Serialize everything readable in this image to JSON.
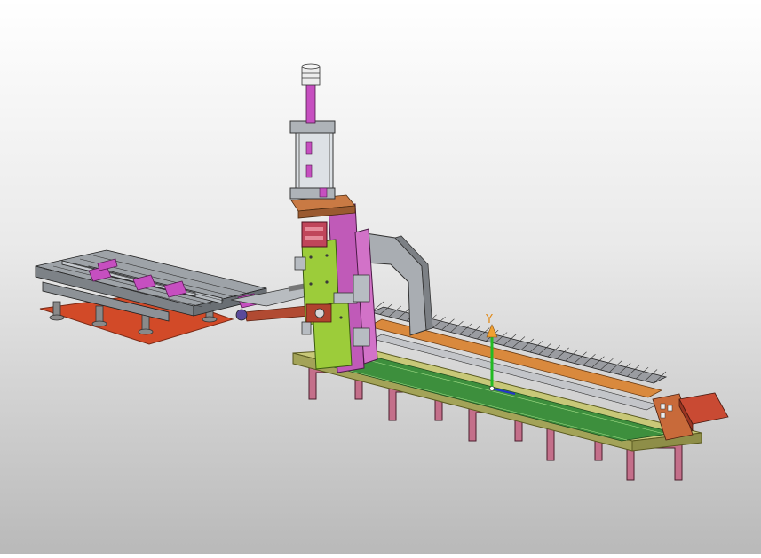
{
  "axis_triad": {
    "y_label": "Y"
  },
  "colors": {
    "background_top": "#ffffff",
    "background_bottom": "#b9b9b9",
    "base_plate": "#c8c878",
    "legs": "#c46f8a",
    "mounting_plate": "#d24a28",
    "column_green": "#9ccc3a",
    "column_purple": "#d272c8",
    "gantry_gray": "#a9adb2",
    "cable_chain": "#8d8f94",
    "motor": "#c94a33",
    "rail_green": "#3d8f3d",
    "belt_orange": "#d9893d",
    "y_axis": "#22bb22",
    "y_cone": "#f0a030"
  }
}
